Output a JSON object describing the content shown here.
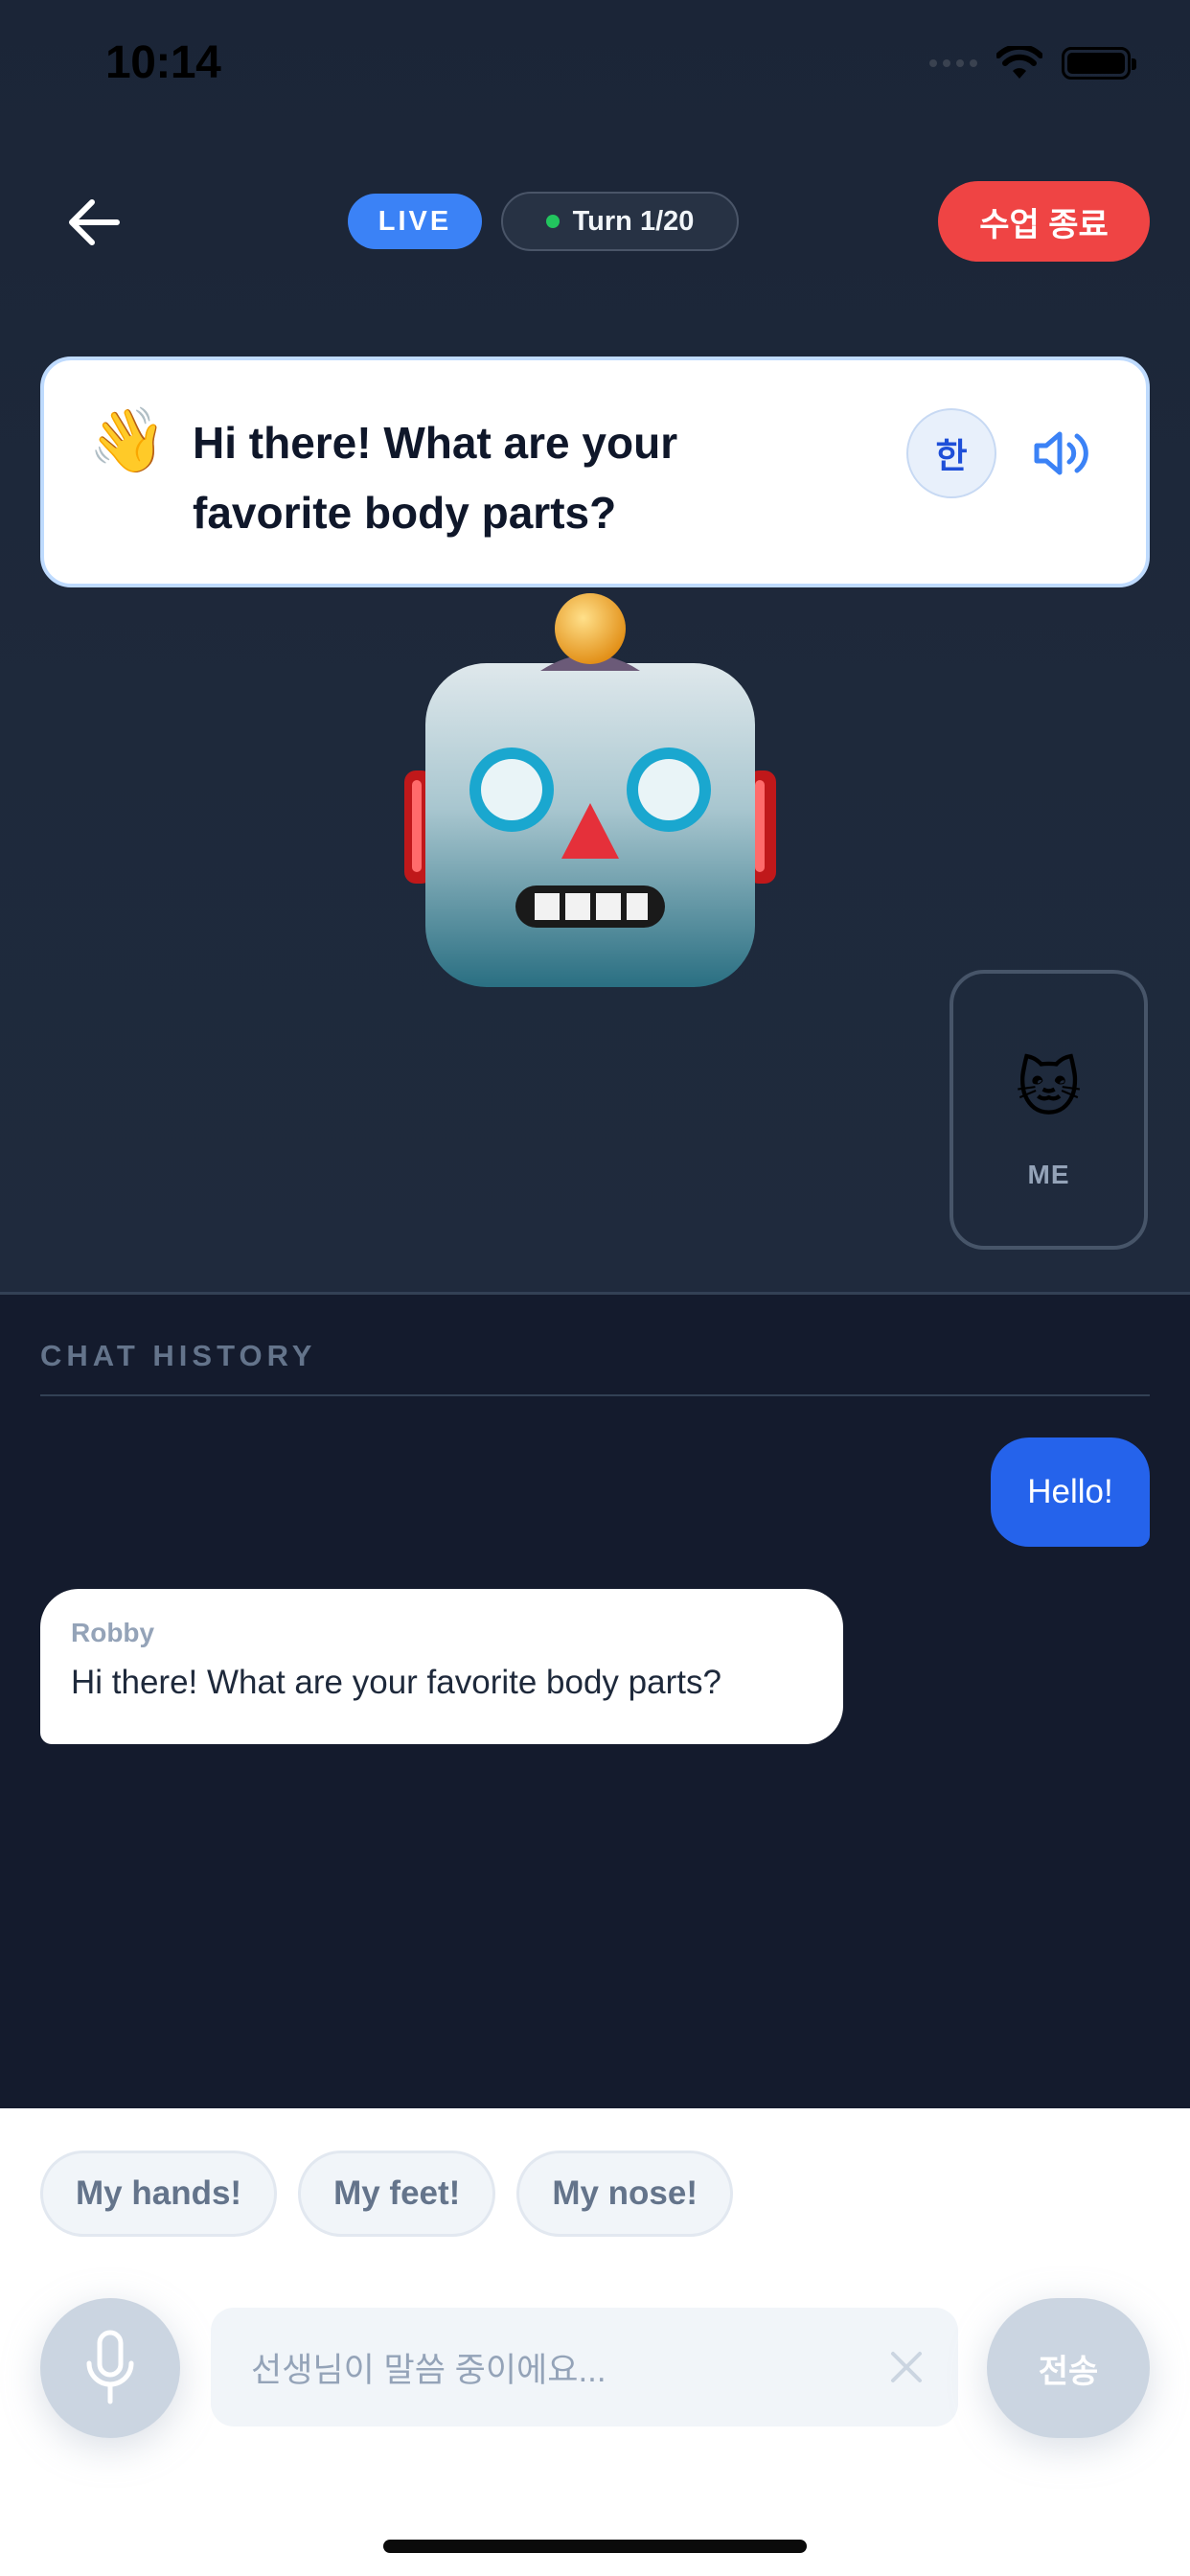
{
  "status_bar": {
    "time": "10:14"
  },
  "header": {
    "live_label": "LIVE",
    "turn_label": "Turn 1/20",
    "end_button_label": "수업 종료"
  },
  "speech_card": {
    "emoji": "👋",
    "text": "Hi there! What are your favorite body parts?",
    "translate_label": "한"
  },
  "me_tile": {
    "emoji": "🐱",
    "label": "ME"
  },
  "chat": {
    "section_label": "CHAT HISTORY",
    "messages": [
      {
        "role": "user",
        "text": "Hello!"
      },
      {
        "role": "bot",
        "sender": "Robby",
        "text": "Hi there! What are your favorite body parts?"
      }
    ]
  },
  "suggestions": [
    "My hands!",
    "My feet!",
    "My nose!"
  ],
  "input": {
    "placeholder": "선생님이 말씀 중이에요...",
    "send_label": "전송"
  },
  "colors": {
    "live": "#3b82f6",
    "end_button": "#ef4444",
    "user_bubble": "#2563eb",
    "turn_dot": "#22c55e"
  },
  "icons": [
    "back-arrow-icon",
    "speaker-icon",
    "mic-icon",
    "clear-icon",
    "wifi-icon",
    "battery-icon",
    "robot-avatar"
  ]
}
